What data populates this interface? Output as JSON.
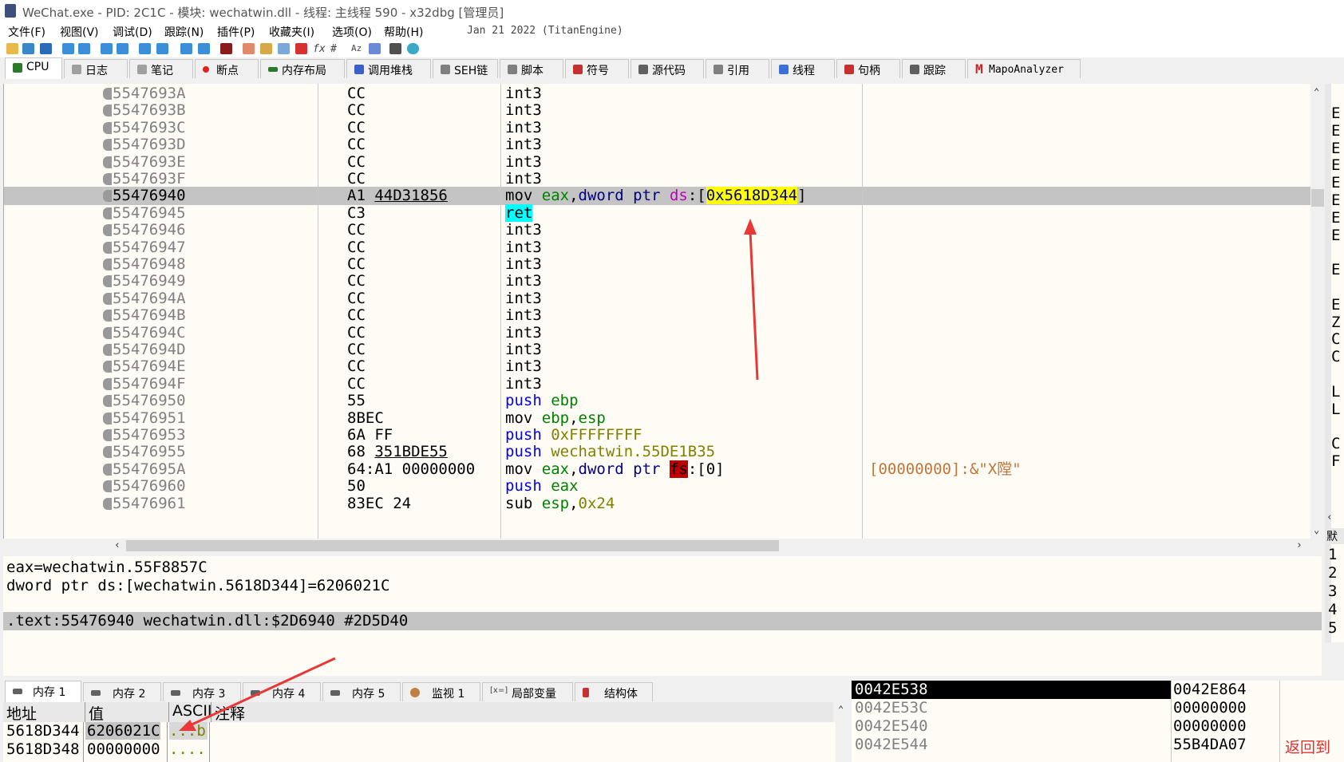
{
  "window": {
    "title": "WeChat.exe - PID: 2C1C - 模块: wechatwin.dll - 线程: 主线程 590 - x32dbg [管理员]"
  },
  "menu": {
    "items": [
      "文件(F)",
      "视图(V)",
      "调试(D)",
      "跟踪(N)",
      "插件(P)",
      "收藏夹(I)",
      "选项(O)",
      "帮助(H)"
    ],
    "build": "Jan 21 2022 (TitanEngine)"
  },
  "tabs": [
    "CPU",
    "日志",
    "笔记",
    "断点",
    "内存布局",
    "调用堆栈",
    "SEH链",
    "脚本",
    "符号",
    "源代码",
    "引用",
    "线程",
    "句柄",
    "跟踪",
    "MapoAnalyzer"
  ],
  "disasm": {
    "rows": [
      {
        "addr": "5547693A",
        "bytes": "CC",
        "asm": "int3"
      },
      {
        "addr": "5547693B",
        "bytes": "CC",
        "asm": "int3"
      },
      {
        "addr": "5547693C",
        "bytes": "CC",
        "asm": "int3"
      },
      {
        "addr": "5547693D",
        "bytes": "CC",
        "asm": "int3"
      },
      {
        "addr": "5547693E",
        "bytes": "CC",
        "asm": "int3"
      },
      {
        "addr": "5547693F",
        "bytes": "CC",
        "asm": "int3"
      },
      {
        "addr": "55476940",
        "bytes": "A1",
        "bytes_arg": "44D31856",
        "sel": true,
        "asm_parts": [
          [
            "mov ",
            "m"
          ],
          [
            "eax",
            "reg"
          ],
          [
            ",",
            "m"
          ],
          [
            "dword ptr ",
            "kw"
          ],
          [
            "ds",
            "seg"
          ],
          [
            ":[",
            "brk"
          ],
          [
            "0x5618D344",
            "hl-yellow"
          ],
          [
            "]",
            "brk"
          ]
        ]
      },
      {
        "addr": "55476945",
        "bytes": "C3",
        "asm_parts": [
          [
            "ret",
            "hl-cyan"
          ]
        ]
      },
      {
        "addr": "55476946",
        "bytes": "CC",
        "asm": "int3"
      },
      {
        "addr": "55476947",
        "bytes": "CC",
        "asm": "int3"
      },
      {
        "addr": "55476948",
        "bytes": "CC",
        "asm": "int3"
      },
      {
        "addr": "55476949",
        "bytes": "CC",
        "asm": "int3"
      },
      {
        "addr": "5547694A",
        "bytes": "CC",
        "asm": "int3"
      },
      {
        "addr": "5547694B",
        "bytes": "CC",
        "asm": "int3"
      },
      {
        "addr": "5547694C",
        "bytes": "CC",
        "asm": "int3"
      },
      {
        "addr": "5547694D",
        "bytes": "CC",
        "asm": "int3"
      },
      {
        "addr": "5547694E",
        "bytes": "CC",
        "asm": "int3"
      },
      {
        "addr": "5547694F",
        "bytes": "CC",
        "asm": "int3"
      },
      {
        "addr": "55476950",
        "bytes": "55",
        "asm_parts": [
          [
            "push ",
            "pu"
          ],
          [
            "ebp",
            "reg"
          ]
        ]
      },
      {
        "addr": "55476951",
        "bytes": "8BEC",
        "asm_parts": [
          [
            "mov ",
            "m"
          ],
          [
            "ebp",
            "reg"
          ],
          [
            ",",
            "m"
          ],
          [
            "esp",
            "reg"
          ]
        ]
      },
      {
        "addr": "55476953",
        "bytes": "6A FF",
        "asm_parts": [
          [
            "push ",
            "pu"
          ],
          [
            "0xFFFFFFFF",
            "num"
          ]
        ]
      },
      {
        "addr": "55476955",
        "bytes": "68",
        "bytes_arg": "351BDE55",
        "asm_parts": [
          [
            "push ",
            "pu"
          ],
          [
            "wechatwin.55DE1B35",
            "num"
          ]
        ]
      },
      {
        "addr": "5547695A",
        "bytes": "64:A1 00000000",
        "asm_parts": [
          [
            "mov ",
            "m"
          ],
          [
            "eax",
            "reg"
          ],
          [
            ",",
            "m"
          ],
          [
            "dword ptr ",
            "kw"
          ],
          [
            "fs",
            "hl-red"
          ],
          [
            ":[0]",
            "brk"
          ]
        ],
        "comment": "[00000000]:&\"X隚\""
      },
      {
        "addr": "55476960",
        "bytes": "50",
        "asm_parts": [
          [
            "push ",
            "pu"
          ],
          [
            "eax",
            "reg"
          ]
        ]
      },
      {
        "addr": "55476961",
        "bytes": "83EC 24",
        "asm_parts": [
          [
            "sub ",
            "m"
          ],
          [
            "esp",
            "reg"
          ],
          [
            ",",
            "m"
          ],
          [
            "0x24",
            "num"
          ]
        ]
      }
    ]
  },
  "info": {
    "line1": "eax=wechatwin.55F8857C",
    "line2": "dword ptr ds:[wechatwin.5618D344]=6206021C",
    "line3": ".text:55476940 wechatwin.dll:$2D6940 #2D5D40"
  },
  "regs_partial": [
    "E",
    "E",
    "E",
    "E",
    "E",
    "E",
    "E",
    "E",
    "",
    "E",
    "",
    "E",
    "Z",
    "C",
    "C",
    "",
    "L",
    "L",
    "",
    "C",
    "F"
  ],
  "mem_tabs": [
    "内存 1",
    "内存 2",
    "内存 3",
    "内存 4",
    "内存 5",
    "监视 1",
    "局部变量",
    "结构体"
  ],
  "dump": {
    "headers": [
      "地址",
      "值",
      "ASCII",
      "注释"
    ],
    "rows": [
      {
        "addr": "5618D344",
        "val": "6206021C",
        "ascii": "...b"
      },
      {
        "addr": "5618D348",
        "val": "00000000",
        "ascii": "...."
      }
    ]
  },
  "stack": {
    "rows": [
      {
        "addr": "0042E538",
        "val": "0042E864",
        "sel": true
      },
      {
        "addr": "0042E53C",
        "val": "00000000"
      },
      {
        "addr": "0042E540",
        "val": "00000000"
      },
      {
        "addr": "0042E544",
        "val": "55B4DA07"
      }
    ],
    "comment": "返回到",
    "sidebar_label": "默",
    "sidebar_nums": [
      "1",
      "2",
      "3",
      "4",
      "5"
    ]
  }
}
